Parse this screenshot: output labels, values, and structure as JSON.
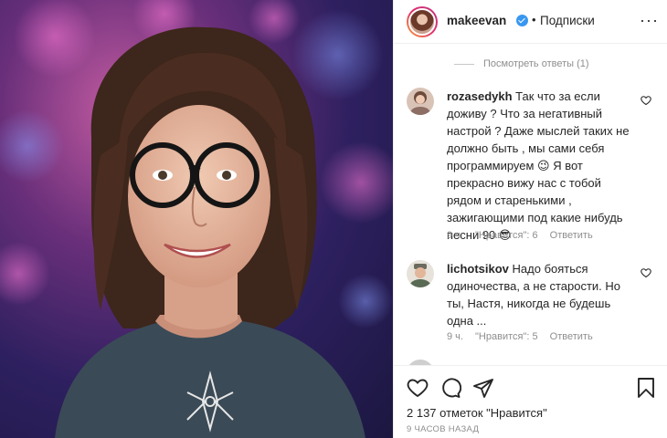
{
  "header": {
    "username": "makeevan",
    "separator": "•",
    "follow_label": "Подписки",
    "more": "···"
  },
  "view_replies": "Посмотреть ответы (1)",
  "comments": [
    {
      "username": "rozasedykh",
      "text": "Так что за если доживу ? Что за негативный настрой ? Даже мыслей таких не должно быть , мы сами себя программируем 😉 Я вот прекрасно вижу нас с тобой рядом и старенькими , зажигающими под какие нибудь песни 90 😎",
      "time": "9 ч.",
      "likes": "\"Нравится\": 6",
      "reply": "Ответить"
    },
    {
      "username": "lichotsikov",
      "text": "Надо бояться одиночества, а не старости. Но ты, Настя, никогда не будешь одна ...",
      "time": "9 ч.",
      "likes": "\"Нравится\": 5",
      "reply": "Ответить"
    }
  ],
  "post": {
    "likes_label": "2 137 отметок \"Нравится\"",
    "posted_ago": "9 ЧАСОВ НАЗАД"
  },
  "colors": {
    "verified": "#3897f0",
    "muted": "#8e8e8e",
    "text": "#262626"
  }
}
